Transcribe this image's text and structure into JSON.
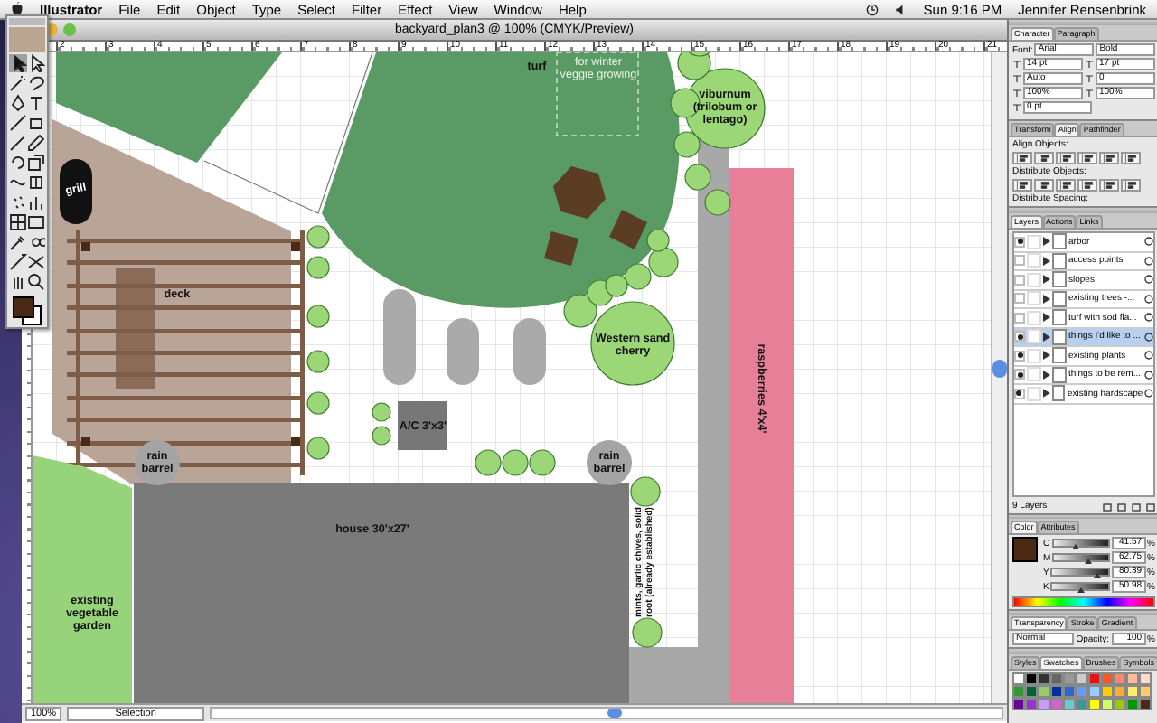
{
  "menubar": {
    "app": "Illustrator",
    "items": [
      "File",
      "Edit",
      "Object",
      "Type",
      "Select",
      "Filter",
      "Effect",
      "View",
      "Window",
      "Help"
    ],
    "clock": "Sun 9:16 PM",
    "user": "Jennifer Rensenbrink"
  },
  "document": {
    "title": "backyard_plan3 @ 100% (CMYK/Preview)",
    "ruler_labels": [
      "2",
      "3",
      "4",
      "5",
      "6",
      "7",
      "8",
      "9",
      "10",
      "11",
      "12",
      "13",
      "14",
      "15",
      "16",
      "17",
      "18",
      "19",
      "20",
      "21"
    ],
    "plan_labels": [
      "turf",
      "for winter veggie growing",
      "grill",
      "deck",
      "viburnum (trilobum or lentago)",
      "Western sand cherry",
      "A/C 3'x3'",
      "rain barrel",
      "rain barrel",
      "house 30'x27'",
      "existing vegetable garden",
      "raspberries 4'x4'",
      "mints, garlic chives, solid root (already established)"
    ],
    "zoom": "100%",
    "tool": "Selection"
  },
  "tools": [
    {
      "kind": "selection",
      "selected": true
    },
    {
      "kind": "direct",
      "selected": false
    },
    {
      "kind": "wand",
      "selected": false
    },
    {
      "kind": "lasso",
      "selected": false
    },
    {
      "kind": "pen",
      "selected": false
    },
    {
      "kind": "type",
      "selected": false
    },
    {
      "kind": "line",
      "selected": false
    },
    {
      "kind": "rect",
      "selected": false
    },
    {
      "kind": "brush",
      "selected": false
    },
    {
      "kind": "pencil",
      "selected": false
    },
    {
      "kind": "rotate",
      "selected": false
    },
    {
      "kind": "scale",
      "selected": false
    },
    {
      "kind": "warp",
      "selected": false
    },
    {
      "kind": "transform",
      "selected": false
    },
    {
      "kind": "symbol",
      "selected": false
    },
    {
      "kind": "graph",
      "selected": false
    },
    {
      "kind": "mesh",
      "selected": false
    },
    {
      "kind": "gradient",
      "selected": false
    },
    {
      "kind": "eyedropper",
      "selected": false
    },
    {
      "kind": "blend",
      "selected": false
    },
    {
      "kind": "slice",
      "selected": false
    },
    {
      "kind": "scissors",
      "selected": false
    },
    {
      "kind": "hand",
      "selected": false
    },
    {
      "kind": "zoom",
      "selected": false
    }
  ],
  "character_panel": {
    "tabs": [
      {
        "label": "Character",
        "selected": true
      },
      {
        "label": "Paragraph",
        "selected": false
      }
    ],
    "font_label": "Font:",
    "font": "Arial",
    "style": "Bold",
    "fields": [
      "14 pt",
      "17 pt",
      "Auto",
      "0",
      "100%",
      "100%",
      "0 pt"
    ]
  },
  "align_panel": {
    "tabs": [
      {
        "label": "Transform",
        "selected": false
      },
      {
        "label": "Align",
        "selected": true
      },
      {
        "label": "Pathfinder",
        "selected": false
      }
    ],
    "sections": [
      "Align Objects:",
      "Distribute Objects:",
      "Distribute Spacing:"
    ]
  },
  "layers_panel": {
    "tabs": [
      {
        "label": "Layers",
        "selected": true
      },
      {
        "label": "Actions",
        "selected": false
      },
      {
        "label": "Links",
        "selected": false
      }
    ],
    "layers": [
      {
        "name": "arbor",
        "visible": true,
        "selected": false
      },
      {
        "name": "access points",
        "visible": false,
        "selected": false
      },
      {
        "name": "slopes",
        "visible": false,
        "selected": false
      },
      {
        "name": "existing trees -...",
        "visible": false,
        "selected": false
      },
      {
        "name": "turf with sod fla...",
        "visible": false,
        "selected": false
      },
      {
        "name": "things I'd like to ...",
        "visible": true,
        "selected": true
      },
      {
        "name": "existing plants",
        "visible": true,
        "selected": false
      },
      {
        "name": "things to be rem...",
        "visible": true,
        "selected": false
      },
      {
        "name": "existing hardscape",
        "visible": true,
        "selected": false
      }
    ],
    "footer": "9 Layers"
  },
  "color_panel": {
    "tabs": [
      {
        "label": "Color",
        "selected": true
      },
      {
        "label": "Attributes",
        "selected": false
      }
    ],
    "channels": [
      {
        "name": "C",
        "value": "41.57",
        "unit": "%",
        "level": 0.42
      },
      {
        "name": "M",
        "value": "62.75",
        "unit": "%",
        "level": 0.63
      },
      {
        "name": "Y",
        "value": "80.39",
        "unit": "%",
        "level": 0.8
      },
      {
        "name": "K",
        "value": "50.98",
        "unit": "%",
        "level": 0.51
      }
    ]
  },
  "transparency_panel": {
    "tabs": [
      {
        "label": "Transparency",
        "selected": true
      },
      {
        "label": "Stroke",
        "selected": false
      },
      {
        "label": "Gradient",
        "selected": false
      }
    ],
    "mode": "Normal",
    "opacity_label": "Opacity:",
    "opacity": "100",
    "unit": "%"
  },
  "swatches_panel": {
    "tabs": [
      {
        "label": "Styles",
        "selected": false
      },
      {
        "label": "Swatches",
        "selected": true
      },
      {
        "label": "Brushes",
        "selected": false
      },
      {
        "label": "Symbols",
        "selected": false
      }
    ],
    "swatches": [
      {
        "color": "#ffffff"
      },
      {
        "color": "#000000"
      },
      {
        "color": "#333333"
      },
      {
        "color": "#666666"
      },
      {
        "color": "#999999"
      },
      {
        "color": "#cccccc"
      },
      {
        "color": "#ee1111"
      },
      {
        "color": "#ff5522"
      },
      {
        "color": "#ff8866"
      },
      {
        "color": "#ffbb99"
      },
      {
        "color": "#ffddcc"
      },
      {
        "color": "#339933"
      },
      {
        "color": "#006633"
      },
      {
        "color": "#99cc66"
      },
      {
        "color": "#003399"
      },
      {
        "color": "#3366cc"
      },
      {
        "color": "#6699ff"
      },
      {
        "color": "#99ccff"
      },
      {
        "color": "#ffcc00"
      },
      {
        "color": "#ffaa33"
      },
      {
        "color": "#ffee66"
      },
      {
        "color": "#ffcc66"
      },
      {
        "color": "#660099"
      },
      {
        "color": "#9933cc"
      },
      {
        "color": "#cc99ff"
      },
      {
        "color": "#cc66cc"
      },
      {
        "color": "#66cccc"
      },
      {
        "color": "#339999"
      },
      {
        "color": "#ffff00"
      },
      {
        "color": "#ccff66"
      },
      {
        "color": "#99cc00"
      },
      {
        "color": "#009900"
      },
      {
        "color": "#4a2a14"
      }
    ]
  }
}
